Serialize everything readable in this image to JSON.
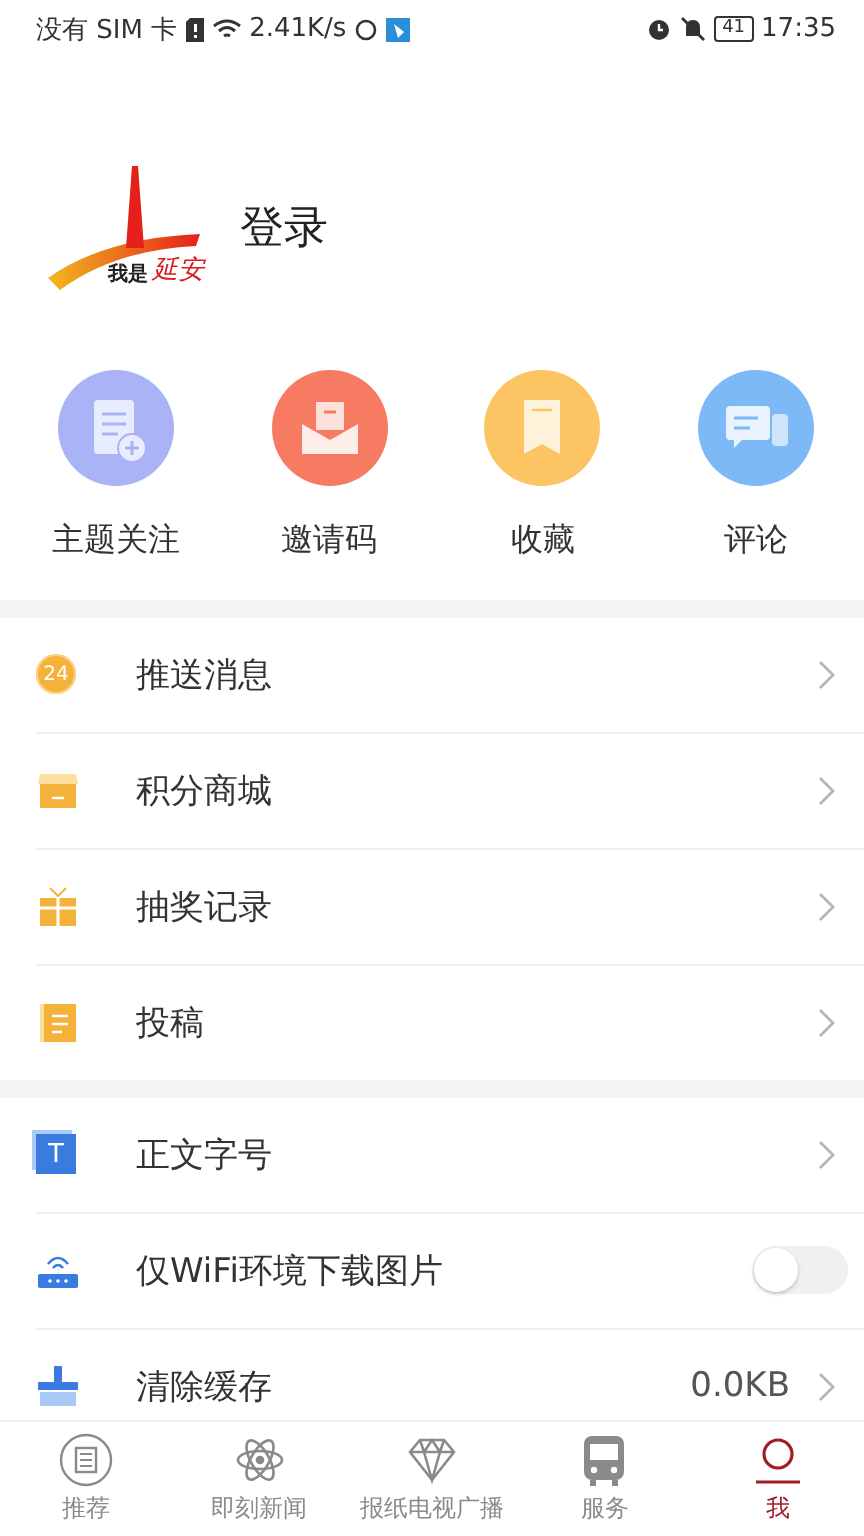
{
  "status_bar": {
    "carrier": "没有 SIM 卡",
    "speed": "2.41K/s",
    "battery": "41",
    "time": "17:35"
  },
  "profile": {
    "logo_caption": "我是",
    "logo_script": "延安",
    "login": "登录"
  },
  "shortcuts": [
    {
      "label": "主题关注",
      "color": "#a9b3f5"
    },
    {
      "label": "邀请码",
      "color": "#f77a62"
    },
    {
      "label": "收藏",
      "color": "#fdc463"
    },
    {
      "label": "评论",
      "color": "#7db8f7"
    }
  ],
  "menu_sections": [
    [
      {
        "kind": "link",
        "label": "推送消息",
        "badge": "24"
      },
      {
        "kind": "link",
        "label": "积分商城"
      },
      {
        "kind": "link",
        "label": "抽奖记录"
      },
      {
        "kind": "link",
        "label": "投稿"
      }
    ],
    [
      {
        "kind": "link",
        "label": "正文字号",
        "icon_letter": "T"
      },
      {
        "kind": "toggle",
        "label": "仅WiFi环境下载图片",
        "on": false
      },
      {
        "kind": "value",
        "label": "清除缓存",
        "value": "0.0KB"
      }
    ]
  ],
  "tab_bar": [
    {
      "label": "推荐",
      "selected": false
    },
    {
      "label": "即刻新闻",
      "selected": false
    },
    {
      "label": "报纸电视广播",
      "selected": false
    },
    {
      "label": "服务",
      "selected": false
    },
    {
      "label": "我",
      "selected": true
    }
  ]
}
